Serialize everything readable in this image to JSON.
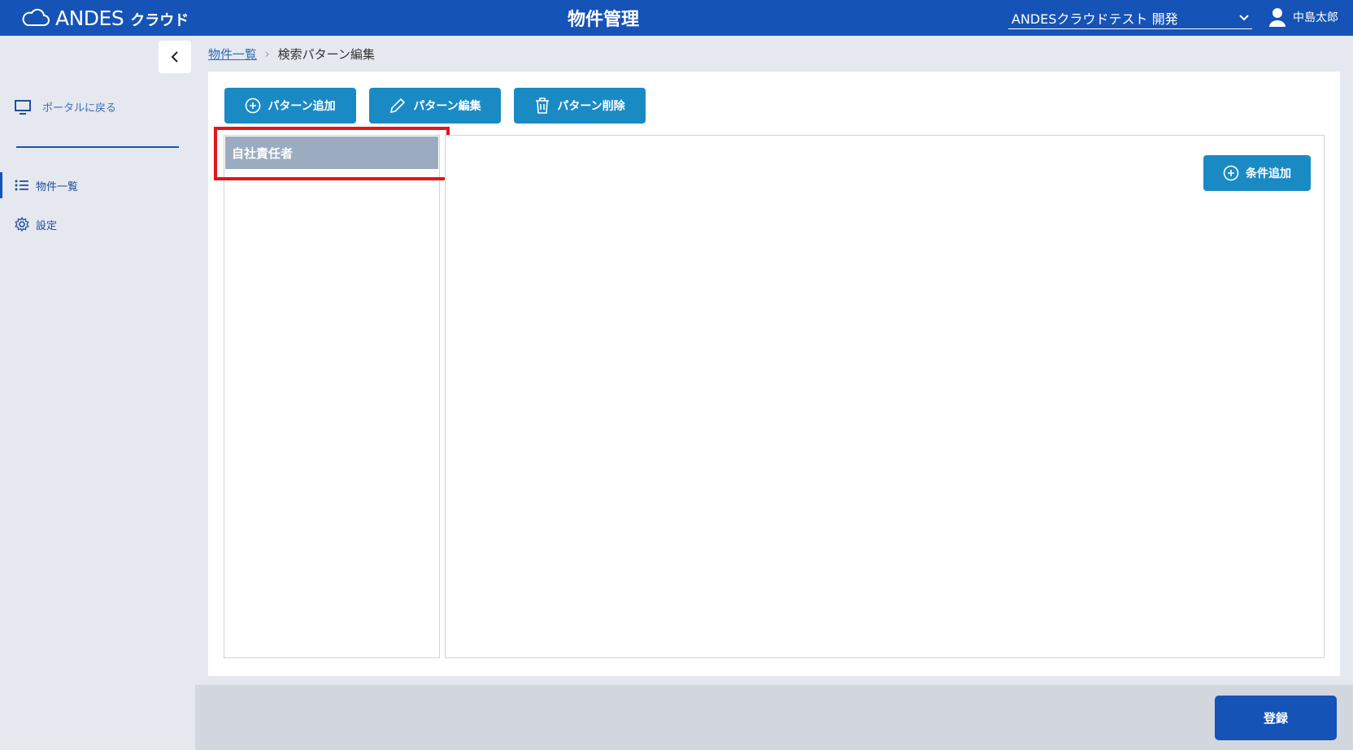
{
  "header": {
    "logo_text": "ANDES",
    "logo_sub": "クラウド",
    "title": "物件管理",
    "tenant": "ANDESクラウドテスト 開発",
    "user_name": "中島太郎"
  },
  "sidebar": {
    "portal_label": "ポータルに戻る",
    "items": [
      {
        "label": "物件一覧",
        "icon": "list-icon",
        "active": true
      },
      {
        "label": "設定",
        "icon": "gear-icon",
        "active": false
      }
    ]
  },
  "breadcrumb": {
    "link": "物件一覧",
    "current": "検索パターン編集"
  },
  "toolbar": {
    "add_label": "パターン追加",
    "edit_label": "パターン編集",
    "delete_label": "パターン削除"
  },
  "patterns": [
    {
      "label": "自社責任者",
      "selected": true
    }
  ],
  "conditions": {
    "add_label": "条件追加"
  },
  "footer": {
    "submit_label": "登録"
  },
  "colors": {
    "header_bg": "#1553b6",
    "button_bg": "#1a8ac4",
    "selected_item_bg": "#9bacc0",
    "highlight": "#e3161b"
  }
}
